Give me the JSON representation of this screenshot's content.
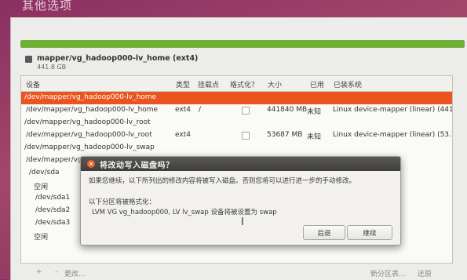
{
  "page": {
    "title": "其他选项"
  },
  "usage": {
    "fill_percent": 100,
    "color": "#6cb12f"
  },
  "partition_title": {
    "name": "mapper/vg_hadoop000-lv_home (ext4)",
    "size": "441.8 GB"
  },
  "table": {
    "headers": {
      "device": "设备",
      "type": "类型",
      "mount": "挂载点",
      "format": "格式化？",
      "size": "大小",
      "used": "已用",
      "system": "已装系统"
    },
    "rows": [
      {
        "device": "/dev/mapper/vg_hadoop000-lv_home",
        "type": "",
        "mount": "",
        "size": "",
        "used": "",
        "system": ""
      },
      {
        "device": "/dev/mapper/vg_hadoop000-lv_home",
        "type": "ext4",
        "mount": "/",
        "size": "441840 MB",
        "used": "未知",
        "system": "Linux device-mapper (linear) (441.8"
      },
      {
        "device": "/dev/mapper/vg_hadoop000-lv_root",
        "type": "",
        "mount": "",
        "size": "",
        "used": "",
        "system": ""
      },
      {
        "device": "/dev/mapper/vg_hadoop000-lv_root",
        "type": "ext4",
        "mount": "",
        "size": "53687 MB",
        "used": "未知",
        "system": "Linux device-mapper (linear) (53.7 C"
      },
      {
        "device": "/dev/mapper/vg_hadoop000-lv_swap",
        "type": "",
        "mount": "",
        "size": "",
        "used": "",
        "system": ""
      },
      {
        "device": "/dev/mapper/vg_hadoop000-lv_swap",
        "type": "",
        "mount": "",
        "size": "",
        "used": "",
        "system": ""
      },
      {
        "device": "/dev/sda",
        "type": "",
        "mount": "",
        "size": "",
        "used": "",
        "system": ""
      },
      {
        "device": "空闲",
        "type": "",
        "mount": "",
        "size": "",
        "used": "",
        "system": ""
      },
      {
        "device": "/dev/sda1",
        "type": "",
        "mount": "",
        "size": "",
        "used": "",
        "system": ""
      },
      {
        "device": "/dev/sda2",
        "type": "",
        "mount": "",
        "size": "",
        "used": "",
        "system": ""
      },
      {
        "device": "/dev/sda3",
        "type": "",
        "mount": "",
        "size": "",
        "used": "",
        "system": ""
      },
      {
        "device": "空闲",
        "type": "",
        "mount": "",
        "size": "",
        "used": "",
        "system": ""
      }
    ]
  },
  "bottom": {
    "add": "+",
    "remove": "-",
    "change": "更改...",
    "new_table": "新分区表...",
    "revert": "还原"
  },
  "dialog": {
    "title": "将改动写入磁盘吗？",
    "close_glyph": "×",
    "message": "如果您继续，以下所列出的修改内容将被写入磁盘。否则您将可以进行进一步的手动修改。",
    "format_heading": "以下分区将被格式化：",
    "format_item": "LVM VG vg_hadoop000, LV lv_swap 设备将被设置为 swap",
    "back": "后退",
    "continue": "继续"
  },
  "colors": {
    "selection": "#e9541f",
    "dialog_titlebar": "#4a4945",
    "close_button": "#ec6331"
  }
}
